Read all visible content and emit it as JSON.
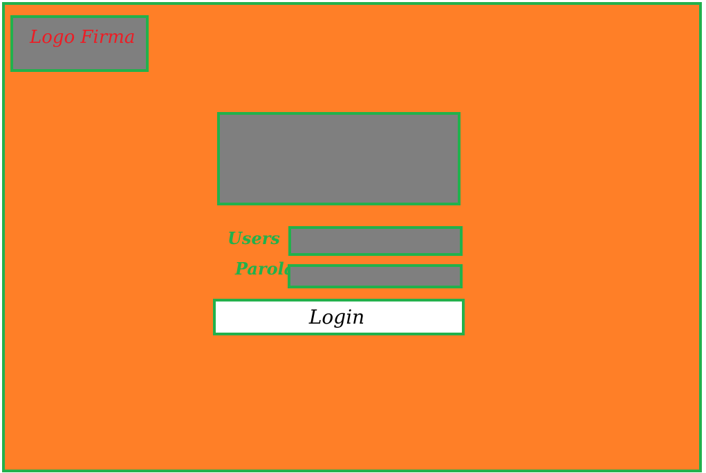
{
  "colors": {
    "background": "#FF7F27",
    "border": "#22B14C",
    "placeholder_box": "#7F7F7F",
    "logo_text": "#ED1C24",
    "label_text": "#22B14C",
    "button_background": "#FFFFFF"
  },
  "header": {
    "logo_text": "Logo Firma"
  },
  "login_form": {
    "users_label": "Users",
    "users_value": "",
    "parola_label": "Parola",
    "parola_value": "",
    "login_button_label": "Login"
  }
}
